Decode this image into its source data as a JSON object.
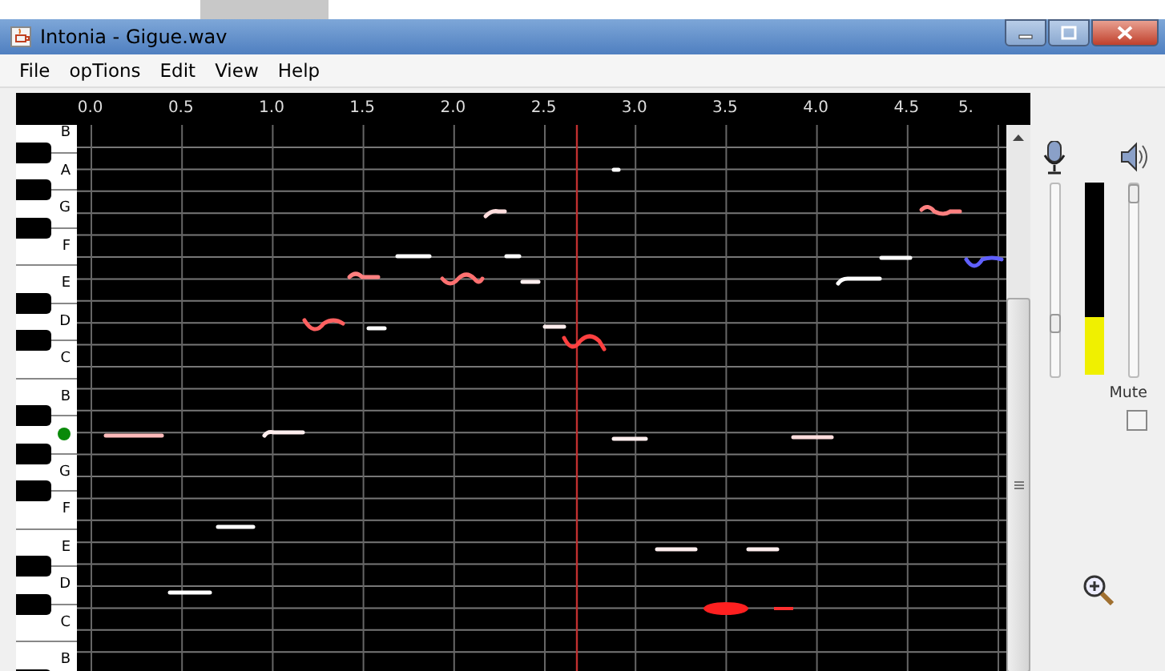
{
  "window": {
    "title": "Intonia - Gigue.wav"
  },
  "menu": [
    "File",
    "opTions",
    "Edit",
    "View",
    "Help"
  ],
  "ruler": {
    "ticks": [
      "0.0",
      "0.5",
      "1.0",
      "1.5",
      "2.0",
      "2.5",
      "3.0",
      "3.5",
      "4.0",
      "4.5",
      "5."
    ]
  },
  "keyboard": [
    {
      "label": "B",
      "sharp_below": true,
      "marked": false
    },
    {
      "label": "A",
      "sharp_below": true,
      "marked": false
    },
    {
      "label": "G",
      "sharp_below": true,
      "marked": false
    },
    {
      "label": "F",
      "sharp_below": false,
      "marked": false
    },
    {
      "label": "E",
      "sharp_below": true,
      "marked": false
    },
    {
      "label": "D",
      "sharp_below": true,
      "marked": false
    },
    {
      "label": "C",
      "sharp_below": false,
      "marked": false
    },
    {
      "label": "B",
      "sharp_below": true,
      "marked": false
    },
    {
      "marked": true,
      "sharp_below": true
    },
    {
      "label": "G",
      "sharp_below": true,
      "marked": false
    },
    {
      "label": "F",
      "sharp_below": false,
      "marked": false
    },
    {
      "label": "E",
      "sharp_below": true,
      "marked": false
    },
    {
      "label": "D",
      "sharp_below": true,
      "marked": false
    },
    {
      "label": "C",
      "sharp_below": false,
      "marked": false
    },
    {
      "label": "B",
      "sharp_below": true,
      "marked": false
    }
  ],
  "mic_slider": {
    "level": 0.25
  },
  "level_meter": {
    "level": 0.3
  },
  "speaker_slider": {
    "level": 1
  },
  "mute": {
    "label": "Mute",
    "checked": false
  }
}
